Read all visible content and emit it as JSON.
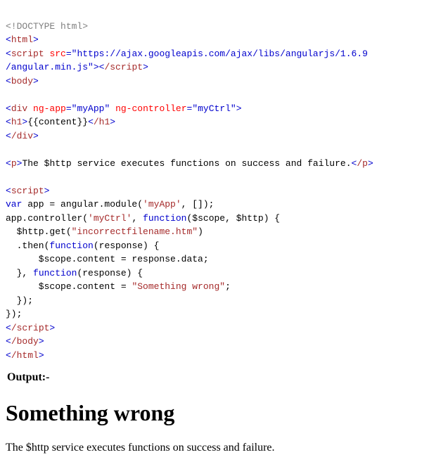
{
  "code": {
    "doctype": "<!DOCTYPE html>",
    "html_open_lt": "<",
    "html_tag": "html",
    "gt": ">",
    "script_tag": "script",
    "src_attr": "src",
    "eq": "=",
    "src_val1": "\"https://ajax.googleapis.com/ajax/libs/angularjs/1.6.9",
    "src_val2": "/angular.min.js\"",
    "script_close": "/script",
    "body_tag": "body",
    "div_tag": "div",
    "ngapp_attr": "ng-app",
    "ngapp_val": "\"myApp\"",
    "ngcontroller_attr": "ng-controller",
    "ngcontroller_val": "\"myCtrl\"",
    "h1_tag": "h1",
    "h1_content": "{{content}}",
    "h1_close": "/h1",
    "div_close": "/div",
    "p_tag": "p",
    "p_text": "The $http service executes functions on success and failure.",
    "p_close": "/p",
    "var_kw": "var",
    "app_eq": " app = angular.module(",
    "myapp_str": "'myApp'",
    "comma_arr": ", []);",
    "app_ctrl": "app.controller(",
    "myctrl_str": "'myCtrl'",
    "comma_sp": ", ",
    "function_kw": "function",
    "fn_args1": "($scope, $http) {",
    "http_get": "  $http.get(",
    "filename_str": "\"incorrectfilename.htm\"",
    "paren_close": ")",
    "then": "  .then(",
    "fn_args2": "(response) {",
    "scope_data": "      $scope.content = response.data;",
    "close_comma": "  }, ",
    "scope_wrong_pre": "      $scope.content = ",
    "wrong_str": "\"Something wrong\"",
    "semicolon": ";",
    "close_brace1": "  });",
    "close_brace2": "});",
    "body_close": "/body",
    "html_close": "/html"
  },
  "output": {
    "label": "Output:-",
    "heading": "Something wrong",
    "paragraph": "The $http service executes functions on success and failure."
  }
}
